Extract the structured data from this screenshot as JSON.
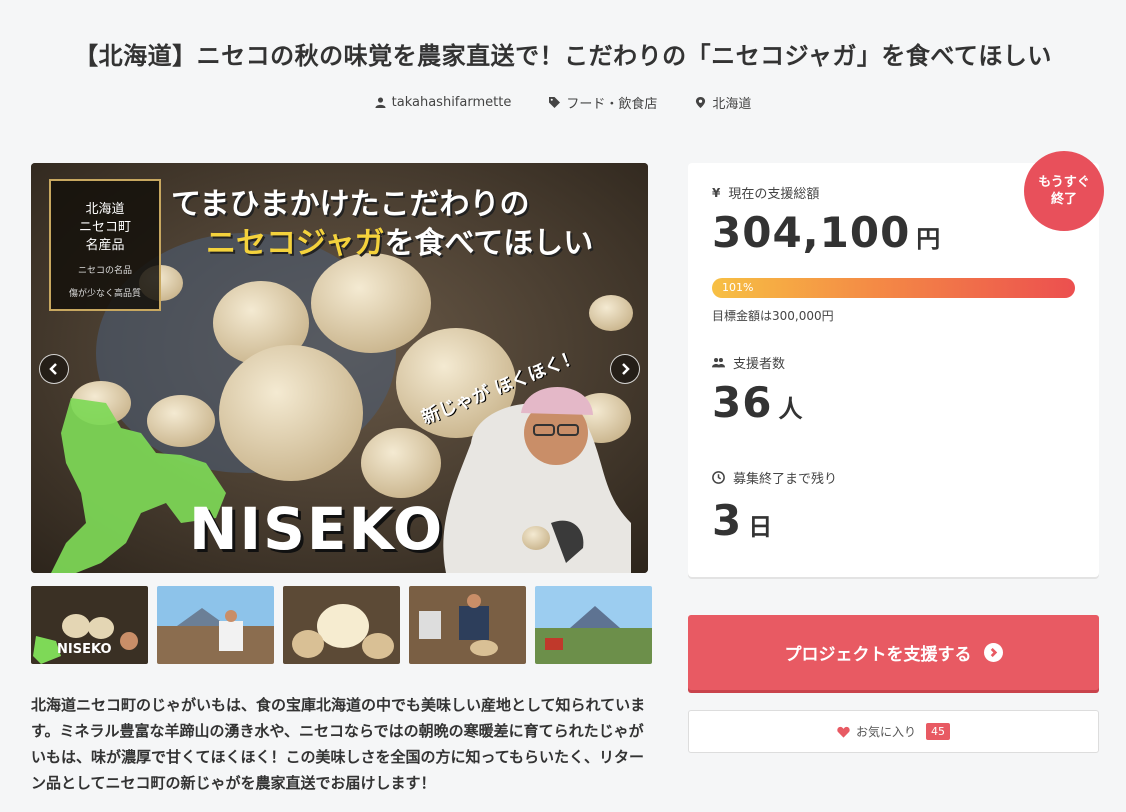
{
  "project": {
    "title": "【北海道】ニセコの秋の味覚を農家直送で！こだわりの「ニセコジャガ」を食べてほしい",
    "owner": "takahashifarmette",
    "category": "フード・飲食店",
    "location": "北海道"
  },
  "hero": {
    "seal_line1": "北海道",
    "seal_line2": "ニセコ町",
    "seal_line3": "名産品",
    "seal_sub1": "ニセコの名品",
    "seal_sub2": "傷が少なく高品質",
    "headline1": "てまひまかけたこだわりの",
    "headline2_highlight": "ニセコジャガ",
    "headline2_rest": "を食べてほしい",
    "tagline": "新じゃが ほくほく！",
    "brand": "NISEKO",
    "prev_icon": "chevron-left-icon",
    "next_icon": "chevron-right-icon"
  },
  "thumbnails": [
    {
      "label": "NISEKO"
    },
    {
      "label": ""
    },
    {
      "label": ""
    },
    {
      "label": ""
    },
    {
      "label": ""
    }
  ],
  "description": "北海道ニセコ町のじゃがいもは、食の宝庫北海道の中でも美味しい産地として知られています。ミネラル豊富な羊蹄山の湧き水や、ニセコならではの朝晩の寒暖差に育てられたじゃがいもは、味が濃厚で甘くてほくほく！この美味しさを全国の方に知ってもらいたく、リターン品としてニセコ町の新じゃがを農家直送でお届けします！",
  "stats": {
    "badge_line1": "もうすぐ",
    "badge_line2": "終了",
    "total_label": "現在の支援総額",
    "total_value": "304,100",
    "total_unit": "円",
    "progress_text": "101%",
    "progress_percent": 101,
    "goal_text": "目標金額は300,000円",
    "backers_label": "支援者数",
    "backers_value": "36",
    "backers_unit": "人",
    "remaining_label": "募集終了まで残り",
    "remaining_value": "3",
    "remaining_unit": "日"
  },
  "actions": {
    "support_label": "プロジェクトを支援する",
    "favorite_label": "お気に入り",
    "favorite_count": "45"
  },
  "colors": {
    "accent": "#e85a63",
    "badge": "#e8505b",
    "progress_start": "#f7c044",
    "progress_end": "#ec4f4f"
  }
}
